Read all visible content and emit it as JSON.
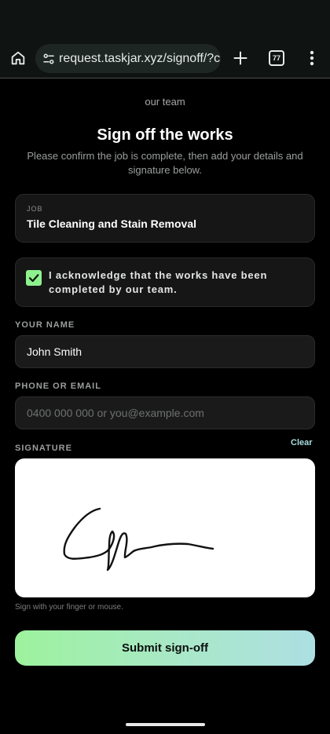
{
  "browser": {
    "url": "request.taskjar.xyz/signoff/?c",
    "tab_count": "77"
  },
  "page": {
    "team_text": "our team",
    "title": "Sign off the works",
    "subtitle": "Please confirm the job is complete, then add your details and signature below."
  },
  "job": {
    "label": "JOB",
    "value": "Tile Cleaning and Stain Removal"
  },
  "acknowledgement": {
    "text": "I acknowledge that the works have been completed by our team.",
    "checked": true
  },
  "name_field": {
    "label": "YOUR NAME",
    "value": "John Smith"
  },
  "contact_field": {
    "label": "PHONE OR EMAIL",
    "value": "",
    "placeholder": "0400 000 000 or you@example.com"
  },
  "signature": {
    "label": "SIGNATURE",
    "clear_label": "Clear",
    "hint": "Sign with your finger or mouse."
  },
  "submit": {
    "label": "Submit sign-off"
  },
  "colors": {
    "accent_green": "#8ef08f",
    "accent_teal": "#addfe2",
    "background": "#000000"
  },
  "icons": {
    "home": "home-icon",
    "site_settings": "tune-icon",
    "new_tab": "plus-icon",
    "tab_switcher": "tabs-icon",
    "menu": "more-vert-icon",
    "check": "check-icon"
  }
}
